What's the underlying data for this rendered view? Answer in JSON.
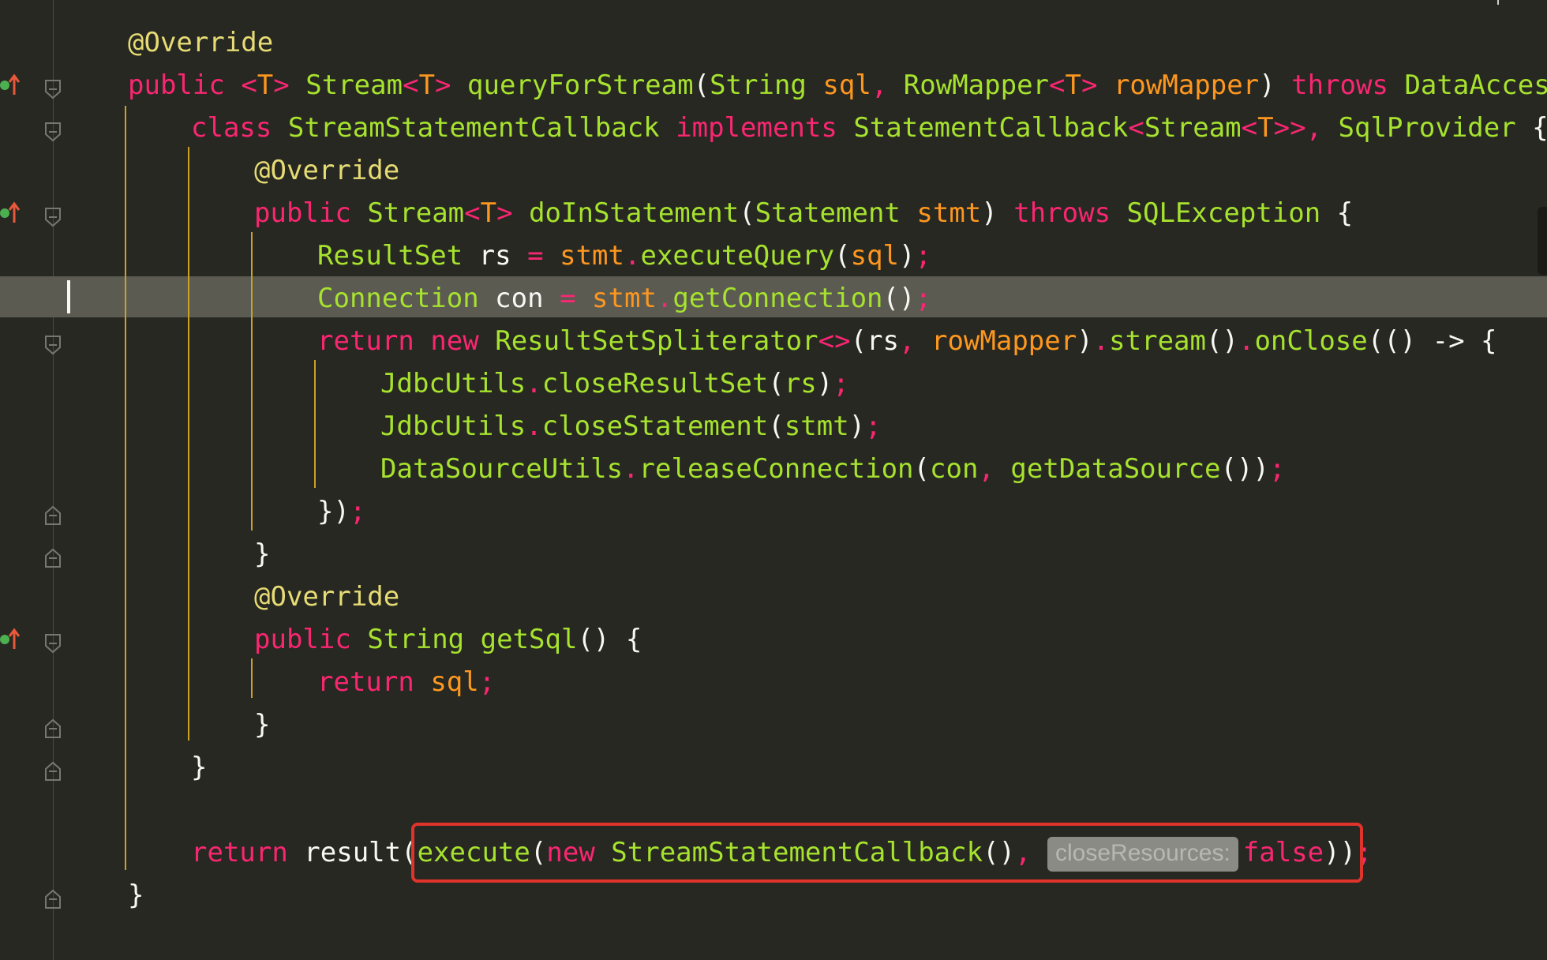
{
  "editor": {
    "theme_colors": {
      "background": "#272822",
      "keyword": "#f92672",
      "type": "#a6e22e",
      "parameter": "#fd971f",
      "annotation": "#e6db74",
      "current_line": "#5b5b52",
      "highlight_box": "#e0332b"
    },
    "lines": [
      {
        "tokens": [
          {
            "c": "a",
            "t": "@Override"
          }
        ]
      },
      {
        "tokens": [
          {
            "c": "k",
            "t": "public"
          },
          {
            "c": "w",
            "t": " "
          },
          {
            "c": "k",
            "t": "<"
          },
          {
            "c": "p",
            "t": "T"
          },
          {
            "c": "k",
            "t": ">"
          },
          {
            "c": "w",
            "t": " "
          },
          {
            "c": "t",
            "t": "Stream"
          },
          {
            "c": "k",
            "t": "<"
          },
          {
            "c": "p",
            "t": "T"
          },
          {
            "c": "k",
            "t": ">"
          },
          {
            "c": "w",
            "t": " "
          },
          {
            "c": "f",
            "t": "queryForStream"
          },
          {
            "c": "w",
            "t": "("
          },
          {
            "c": "t",
            "t": "String"
          },
          {
            "c": "w",
            "t": " "
          },
          {
            "c": "p",
            "t": "sql"
          },
          {
            "c": "k",
            "t": ","
          },
          {
            "c": "w",
            "t": " "
          },
          {
            "c": "t",
            "t": "RowMapper"
          },
          {
            "c": "k",
            "t": "<"
          },
          {
            "c": "p",
            "t": "T"
          },
          {
            "c": "k",
            "t": ">"
          },
          {
            "c": "w",
            "t": " "
          },
          {
            "c": "p",
            "t": "rowMapper"
          },
          {
            "c": "w",
            "t": ") "
          },
          {
            "c": "k",
            "t": "throws"
          },
          {
            "c": "w",
            "t": " "
          },
          {
            "c": "t",
            "t": "DataAccessException {"
          }
        ]
      },
      {
        "tokens": [
          {
            "c": "k",
            "t": "class"
          },
          {
            "c": "w",
            "t": " "
          },
          {
            "c": "t",
            "t": "StreamStatementCallback"
          },
          {
            "c": "w",
            "t": " "
          },
          {
            "c": "k",
            "t": "implements"
          },
          {
            "c": "w",
            "t": " "
          },
          {
            "c": "t",
            "t": "StatementCallback"
          },
          {
            "c": "k",
            "t": "<"
          },
          {
            "c": "t",
            "t": "Stream"
          },
          {
            "c": "k",
            "t": "<"
          },
          {
            "c": "p",
            "t": "T"
          },
          {
            "c": "k",
            "t": ">>"
          },
          {
            "c": "k",
            "t": ","
          },
          {
            "c": "w",
            "t": " "
          },
          {
            "c": "t",
            "t": "SqlProvider"
          },
          {
            "c": "w",
            "t": " {"
          }
        ]
      },
      {
        "tokens": [
          {
            "c": "a",
            "t": "@Override"
          }
        ]
      },
      {
        "tokens": [
          {
            "c": "k",
            "t": "public"
          },
          {
            "c": "w",
            "t": " "
          },
          {
            "c": "t",
            "t": "Stream"
          },
          {
            "c": "k",
            "t": "<"
          },
          {
            "c": "p",
            "t": "T"
          },
          {
            "c": "k",
            "t": ">"
          },
          {
            "c": "w",
            "t": " "
          },
          {
            "c": "f",
            "t": "doInStatement"
          },
          {
            "c": "w",
            "t": "("
          },
          {
            "c": "t",
            "t": "Statement"
          },
          {
            "c": "w",
            "t": " "
          },
          {
            "c": "p",
            "t": "stmt"
          },
          {
            "c": "w",
            "t": ") "
          },
          {
            "c": "k",
            "t": "throws"
          },
          {
            "c": "w",
            "t": " "
          },
          {
            "c": "t",
            "t": "SQLException"
          },
          {
            "c": "w",
            "t": " {"
          }
        ]
      },
      {
        "tokens": [
          {
            "c": "t",
            "t": "ResultSet"
          },
          {
            "c": "w",
            "t": " rs "
          },
          {
            "c": "k",
            "t": "="
          },
          {
            "c": "w",
            "t": " "
          },
          {
            "c": "p",
            "t": "stmt"
          },
          {
            "c": "k",
            "t": "."
          },
          {
            "c": "f",
            "t": "executeQuery"
          },
          {
            "c": "w",
            "t": "("
          },
          {
            "c": "p",
            "t": "sql"
          },
          {
            "c": "w",
            "t": ")"
          },
          {
            "c": "k",
            "t": ";"
          }
        ]
      },
      {
        "tokens": [
          {
            "c": "t",
            "t": "Connection"
          },
          {
            "c": "w",
            "t": " con "
          },
          {
            "c": "k",
            "t": "="
          },
          {
            "c": "w",
            "t": " "
          },
          {
            "c": "p",
            "t": "stmt"
          },
          {
            "c": "k",
            "t": "."
          },
          {
            "c": "f",
            "t": "getConnection"
          },
          {
            "c": "w",
            "t": "()"
          },
          {
            "c": "k",
            "t": ";"
          }
        ]
      },
      {
        "tokens": [
          {
            "c": "k",
            "t": "return"
          },
          {
            "c": "w",
            "t": " "
          },
          {
            "c": "k",
            "t": "new"
          },
          {
            "c": "w",
            "t": " "
          },
          {
            "c": "t",
            "t": "ResultSetSpliterator"
          },
          {
            "c": "k",
            "t": "<>"
          },
          {
            "c": "w",
            "t": "(rs"
          },
          {
            "c": "k",
            "t": ","
          },
          {
            "c": "w",
            "t": " "
          },
          {
            "c": "p",
            "t": "rowMapper"
          },
          {
            "c": "w",
            "t": ")"
          },
          {
            "c": "k",
            "t": "."
          },
          {
            "c": "f",
            "t": "stream"
          },
          {
            "c": "w",
            "t": "()"
          },
          {
            "c": "k",
            "t": "."
          },
          {
            "c": "f",
            "t": "onClose"
          },
          {
            "c": "w",
            "t": "(() -> {"
          }
        ]
      },
      {
        "tokens": [
          {
            "c": "t",
            "t": "JdbcUtils"
          },
          {
            "c": "k",
            "t": "."
          },
          {
            "c": "f",
            "t": "closeResultSet"
          },
          {
            "c": "w",
            "t": "("
          },
          {
            "c": "t",
            "t": "rs"
          },
          {
            "c": "w",
            "t": ")"
          },
          {
            "c": "k",
            "t": ";"
          }
        ]
      },
      {
        "tokens": [
          {
            "c": "t",
            "t": "JdbcUtils"
          },
          {
            "c": "k",
            "t": "."
          },
          {
            "c": "f",
            "t": "closeStatement"
          },
          {
            "c": "w",
            "t": "("
          },
          {
            "c": "t",
            "t": "stmt"
          },
          {
            "c": "w",
            "t": ")"
          },
          {
            "c": "k",
            "t": ";"
          }
        ]
      },
      {
        "tokens": [
          {
            "c": "t",
            "t": "DataSourceUtils"
          },
          {
            "c": "k",
            "t": "."
          },
          {
            "c": "f",
            "t": "releaseConnection"
          },
          {
            "c": "w",
            "t": "("
          },
          {
            "c": "t",
            "t": "con"
          },
          {
            "c": "k",
            "t": ","
          },
          {
            "c": "w",
            "t": " "
          },
          {
            "c": "f",
            "t": "getDataSource"
          },
          {
            "c": "w",
            "t": "())"
          },
          {
            "c": "k",
            "t": ";"
          }
        ]
      },
      {
        "tokens": [
          {
            "c": "w",
            "t": "})"
          },
          {
            "c": "k",
            "t": ";"
          }
        ]
      },
      {
        "tokens": [
          {
            "c": "w",
            "t": "}"
          }
        ]
      },
      {
        "tokens": [
          {
            "c": "a",
            "t": "@Override"
          }
        ]
      },
      {
        "tokens": [
          {
            "c": "k",
            "t": "public"
          },
          {
            "c": "w",
            "t": " "
          },
          {
            "c": "t",
            "t": "String"
          },
          {
            "c": "w",
            "t": " "
          },
          {
            "c": "f",
            "t": "getSql"
          },
          {
            "c": "w",
            "t": "() {"
          }
        ]
      },
      {
        "tokens": [
          {
            "c": "k",
            "t": "return"
          },
          {
            "c": "w",
            "t": " "
          },
          {
            "c": "p",
            "t": "sql"
          },
          {
            "c": "k",
            "t": ";"
          }
        ]
      },
      {
        "tokens": [
          {
            "c": "w",
            "t": "}"
          }
        ]
      },
      {
        "tokens": [
          {
            "c": "w",
            "t": "}"
          }
        ]
      },
      {
        "tokens": []
      },
      {
        "tokens": [
          {
            "c": "k",
            "t": "return"
          },
          {
            "c": "w",
            "t": " result("
          },
          {
            "c": "f",
            "t": "execute"
          },
          {
            "c": "w",
            "t": "("
          },
          {
            "c": "k",
            "t": "new"
          },
          {
            "c": "w",
            "t": " "
          },
          {
            "c": "t",
            "t": "StreamStatementCallback"
          },
          {
            "c": "w",
            "t": "()"
          },
          {
            "c": "k",
            "t": ","
          },
          {
            "c": "w",
            "t": " "
          },
          {
            "c": "hint",
            "t": "closeResources:"
          },
          {
            "c": "k",
            "t": "false"
          },
          {
            "c": "w",
            "t": "))"
          },
          {
            "c": "k",
            "t": ";"
          }
        ]
      },
      {
        "tokens": [
          {
            "c": "w",
            "t": "}"
          }
        ]
      }
    ],
    "highlighted_statement": "execute(new StreamStatementCallback(), closeResources: false));"
  }
}
